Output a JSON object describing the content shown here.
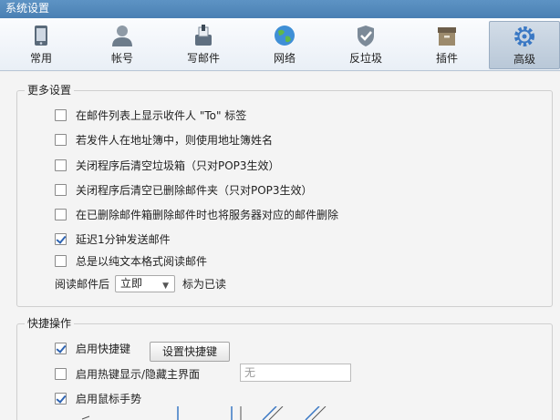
{
  "window": {
    "title": "系统设置"
  },
  "tabs": [
    {
      "label": "常用",
      "icon": "phone-icon"
    },
    {
      "label": "帐号",
      "icon": "user-icon"
    },
    {
      "label": "写邮件",
      "icon": "compose-icon"
    },
    {
      "label": "网络",
      "icon": "globe-icon"
    },
    {
      "label": "反垃圾",
      "icon": "shield-icon"
    },
    {
      "label": "插件",
      "icon": "box-icon"
    },
    {
      "label": "高级",
      "icon": "gear-icon"
    }
  ],
  "active_tab": "高级",
  "more_settings": {
    "title": "更多设置",
    "options": [
      {
        "label": "在邮件列表上显示收件人 \"To\" 标签",
        "checked": false
      },
      {
        "label": "若发件人在地址簿中，则使用地址簿姓名",
        "checked": false
      },
      {
        "label": "关闭程序后清空垃圾箱（只对POP3生效）",
        "checked": false
      },
      {
        "label": "关闭程序后清空已删除邮件夹（只对POP3生效）",
        "checked": false
      },
      {
        "label": "在已删除邮件箱删除邮件时也将服务器对应的邮件删除",
        "checked": false
      },
      {
        "label": "延迟1分钟发送邮件",
        "checked": true
      },
      {
        "label": "总是以纯文本格式阅读邮件",
        "checked": false
      }
    ],
    "read_after": {
      "prefix": "阅读邮件后",
      "value": "立即",
      "suffix": "标为已读"
    }
  },
  "shortcuts": {
    "title": "快捷操作",
    "enable_shortcuts": {
      "label": "启用快捷键",
      "checked": true
    },
    "set_shortcut_button": "设置快捷键",
    "hotkey_toggle": {
      "label": "启用热键显示/隐藏主界面",
      "checked": false
    },
    "hotkey_value": "无",
    "mouse_gesture": {
      "label": "启用鼠标手势",
      "checked": true
    }
  },
  "colors": {
    "accent": "#2d63b2",
    "titlebar": "#4f86b9",
    "active_tab": "#c3d0de"
  }
}
